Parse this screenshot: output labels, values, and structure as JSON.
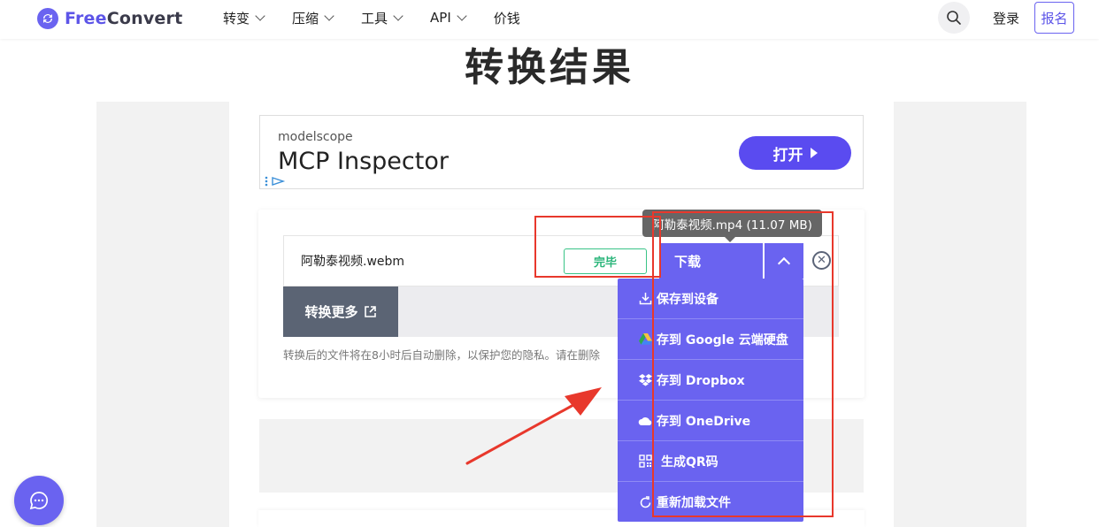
{
  "header": {
    "logo_free": "Free",
    "logo_convert": "Convert",
    "nav": [
      {
        "label": "转变",
        "has_dropdown": true
      },
      {
        "label": "压缩",
        "has_dropdown": true
      },
      {
        "label": "工具",
        "has_dropdown": true
      },
      {
        "label": "API",
        "has_dropdown": true
      },
      {
        "label": "价钱",
        "has_dropdown": false
      }
    ],
    "login": "登录",
    "signup": "报名"
  },
  "page_title": "转换结果",
  "ad": {
    "brand": "modelscope",
    "title": "MCP Inspector",
    "button": "打开"
  },
  "file": {
    "name": "阿勒泰视频.webm",
    "status": "完毕",
    "download_label": "下载",
    "convert_more": "转换更多",
    "note": "转换后的文件将在8小时后自动删除，以保护您的隐私。请在删除"
  },
  "tooltip": "阿勒泰视频.mp4 (11.07 MB)",
  "menu": {
    "items": [
      {
        "icon": "download-icon",
        "label": "保存到设备"
      },
      {
        "icon": "google-drive-icon",
        "label": "存到 Google 云端硬盘"
      },
      {
        "icon": "dropbox-icon",
        "label": "存到 Dropbox"
      },
      {
        "icon": "onedrive-icon",
        "label": "存到 OneDrive"
      },
      {
        "icon": "qr-code-icon",
        "label": "生成QR码"
      },
      {
        "icon": "reload-icon",
        "label": "重新加载文件"
      }
    ]
  },
  "colors": {
    "brand": "#6a63f0",
    "success": "#39c487",
    "annotation": "#e8382c",
    "secondary_button": "#5b6474"
  }
}
